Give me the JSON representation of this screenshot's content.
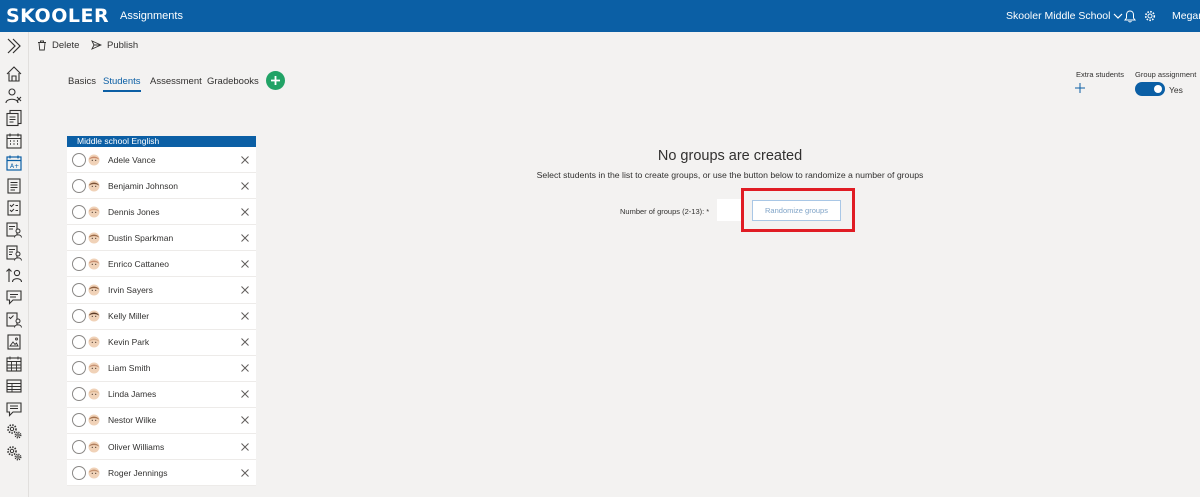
{
  "header": {
    "logo": "SKOOLER",
    "app_title": "Assignments",
    "school": "Skooler Middle School",
    "user": "Megan"
  },
  "rail_icons": [
    "expand-chevrons-icon",
    "home-icon",
    "user-remove-icon",
    "documents-icon",
    "calendar-icon",
    "grade-calendar-icon",
    "notes-icon",
    "checklist-icon",
    "user-document-icon",
    "user-list-icon",
    "user-sort-icon",
    "chat-icon",
    "user-check-icon",
    "image-document-icon",
    "calendar-grid-icon",
    "table-icon",
    "feedback-icon",
    "settings-gears-icon",
    "settings-gears-alt-icon"
  ],
  "commands": {
    "delete": "Delete",
    "publish": "Publish"
  },
  "tabs": [
    {
      "label": "Basics",
      "active": false
    },
    {
      "label": "Students",
      "active": true
    },
    {
      "label": "Assessment",
      "active": false
    },
    {
      "label": "Gradebooks",
      "active": false
    }
  ],
  "right_controls": {
    "extra_students_label": "Extra students",
    "group_assignment_label": "Group assignment",
    "group_assignment_value": "Yes"
  },
  "student_list": {
    "title": "Middle school English",
    "students": [
      {
        "name": "Adele Vance"
      },
      {
        "name": "Benjamin Johnson"
      },
      {
        "name": "Dennis Jones"
      },
      {
        "name": "Dustin Sparkman"
      },
      {
        "name": "Enrico Cattaneo"
      },
      {
        "name": "Irvin Sayers"
      },
      {
        "name": "Kelly Miller"
      },
      {
        "name": "Kevin Park"
      },
      {
        "name": "Liam Smith"
      },
      {
        "name": "Linda James"
      },
      {
        "name": "Nestor Wilke"
      },
      {
        "name": "Oliver Williams"
      },
      {
        "name": "Roger Jennings"
      }
    ]
  },
  "empty_state": {
    "title": "No groups are created",
    "description": "Select students in the list to create groups, or use the button below to randomize a number of groups",
    "groups_label": "Number of groups (2-13): *",
    "groups_value": "",
    "randomize_button": "Randomize groups"
  },
  "colors": {
    "brand": "#0b5fa5",
    "add_button": "#21a366",
    "highlight": "#e01c24"
  }
}
